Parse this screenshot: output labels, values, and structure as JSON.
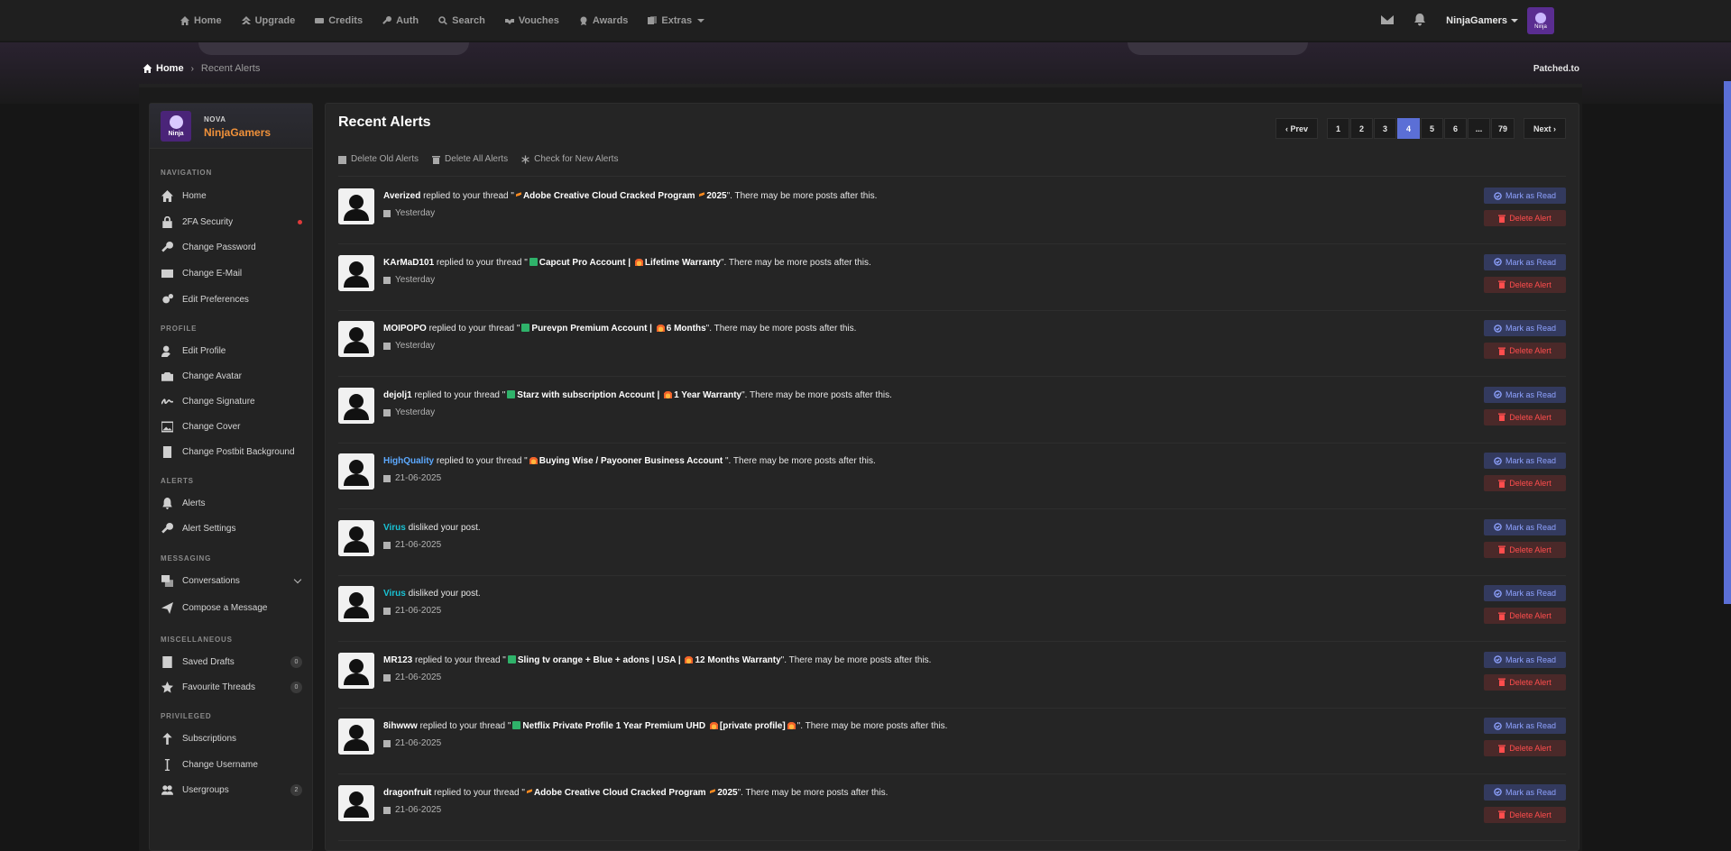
{
  "nav": {
    "items": [
      {
        "label": "Home",
        "icon": "home-icon"
      },
      {
        "label": "Upgrade",
        "icon": "upgrade-icon"
      },
      {
        "label": "Credits",
        "icon": "credits-icon"
      },
      {
        "label": "Auth",
        "icon": "key-icon"
      },
      {
        "label": "Search",
        "icon": "search-icon"
      },
      {
        "label": "Vouches",
        "icon": "handshake-icon"
      },
      {
        "label": "Awards",
        "icon": "award-icon"
      },
      {
        "label": "Extras",
        "icon": "extras-icon"
      }
    ],
    "username": "NinjaGamers",
    "avatar_text": "Ninja"
  },
  "breadcrumb": {
    "home": "Home",
    "current": "Recent Alerts"
  },
  "site_name": "Patched.to",
  "sidebar": {
    "role": "NOVA",
    "username": "NinjaGamers",
    "avatar_text": "Ninja",
    "sections": {
      "navigation": "NAVIGATION",
      "profile": "PROFILE",
      "alerts": "ALERTS",
      "messaging": "MESSAGING",
      "misc": "MISCELLANEOUS",
      "privileged": "PRIVILEGED"
    },
    "items": {
      "home": "Home",
      "security": "2FA Security",
      "password": "Change Password",
      "email": "Change E-Mail",
      "prefs": "Edit Preferences",
      "edit_profile": "Edit Profile",
      "avatar": "Change Avatar",
      "signature": "Change Signature",
      "cover": "Change Cover",
      "postbit": "Change Postbit Background",
      "alerts": "Alerts",
      "alert_settings": "Alert Settings",
      "conversations": "Conversations",
      "compose": "Compose a Message",
      "drafts": "Saved Drafts",
      "drafts_count": "0",
      "favs": "Favourite Threads",
      "favs_count": "0",
      "subs": "Subscriptions",
      "change_username": "Change Username",
      "usergroups": "Usergroups",
      "usergroups_count": "2"
    }
  },
  "main": {
    "title": "Recent Alerts",
    "pager": {
      "prev": "Prev",
      "pages": [
        "1",
        "2",
        "3",
        "4",
        "5",
        "6",
        "...",
        "79"
      ],
      "active": "4",
      "next": "Next"
    },
    "actions": {
      "delete_old": "Delete Old Alerts",
      "delete_all": "Delete All Alerts",
      "check_new": "Check for New Alerts"
    },
    "mark_read": "Mark as Read",
    "delete_alert": "Delete Alert",
    "alerts": [
      {
        "user": "Averized",
        "action": " replied to your thread \"",
        "thread_a": "Adobe Creative Cloud Cracked Program",
        "thread_b": "2025",
        "suffix": "\". There may be more posts after this.",
        "date": "Yesterday"
      },
      {
        "user": "KArMaD101",
        "action": " replied to your thread \"",
        "thread_a": "Capcut Pro Account |",
        "thread_b": "Lifetime Warranty",
        "suffix": "\". There may be more posts after this.",
        "date": "Yesterday"
      },
      {
        "user": "MOIPOPO",
        "action": " replied to your thread \"",
        "thread_a": "Purevpn Premium Account |",
        "thread_b": "6 Months",
        "suffix": "\". There may be more posts after this.",
        "date": "Yesterday"
      },
      {
        "user": "dejolj1",
        "action": " replied to your thread \"",
        "thread_a": "Starz with subscription Account |",
        "thread_b": "1 Year Warranty",
        "suffix": "\". There may be more posts after this.",
        "date": "Yesterday"
      },
      {
        "user": "HighQuality",
        "action": " replied to your thread \"",
        "thread_a": "Buying Wise / Payooner Business Account",
        "thread_b": "",
        "suffix": "\". There may be more posts after this.",
        "date": "21-06-2025"
      },
      {
        "user": "Virus",
        "action": " disliked your post.",
        "thread_a": "",
        "thread_b": "",
        "suffix": "",
        "date": "21-06-2025"
      },
      {
        "user": "Virus",
        "action": " disliked your post.",
        "thread_a": "",
        "thread_b": "",
        "suffix": "",
        "date": "21-06-2025"
      },
      {
        "user": "MR123",
        "action": " replied to your thread \"",
        "thread_a": "Sling tv orange + Blue + adons | USA |",
        "thread_b": "12 Months Warranty",
        "suffix": "\". There may be more posts after this.",
        "date": "21-06-2025"
      },
      {
        "user": "8ihwww",
        "action": " replied to your thread \"",
        "thread_a": "Netflix Private Profile 1 Year Premium UHD",
        "thread_b": "[private profile]",
        "suffix": "\". There may be more posts after this.",
        "date": "21-06-2025"
      },
      {
        "user": "dragonfruit",
        "action": " replied to your thread \"",
        "thread_a": "Adobe Creative Cloud Cracked Program",
        "thread_b": "2025",
        "suffix": "\". There may be more posts after this.",
        "date": "21-06-2025"
      }
    ]
  },
  "colors": {
    "accent": "#5b6fd6",
    "brand_orange": "#f0913a",
    "danger": "#ff4d4d",
    "link_blue": "#5ca9ff",
    "cyan": "#19c2d4"
  }
}
